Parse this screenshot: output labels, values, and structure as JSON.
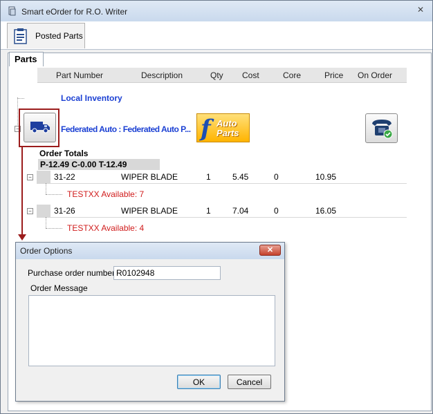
{
  "window": {
    "title": "Smart eOrder for R.O. Writer",
    "close_glyph": "✕"
  },
  "toolbar": {
    "posted_parts_label": "Posted Parts"
  },
  "tabs": {
    "parts_label": "Parts"
  },
  "grid": {
    "columns": [
      "Part Number",
      "Description",
      "Qty",
      "Cost",
      "Core",
      "Price",
      "On Order"
    ]
  },
  "tree": {
    "local_inventory": "Local Inventory",
    "vendor_name": "Federated Auto : Federated Auto P...",
    "vendor_logo_text": "Auto Parts",
    "order_totals_label": "Order Totals",
    "order_totals_value": "P-12.49 C-0.00 T-12.49"
  },
  "rows": [
    {
      "part_number": "31-22",
      "description": "WIPER BLADE",
      "qty": "1",
      "cost": "5.45",
      "core": "0",
      "price": "10.95",
      "availability": "TESTXX Available: 7"
    },
    {
      "part_number": "31-26",
      "description": "WIPER BLADE",
      "qty": "1",
      "cost": "7.04",
      "core": "0",
      "price": "16.05",
      "availability": "TESTXX Available: 4"
    }
  ],
  "dialog": {
    "title": "Order Options",
    "close_glyph": "✕",
    "po_label": "Purchase order number:",
    "po_value": "R0102948",
    "message_label": "Order Message",
    "message_value": "",
    "ok_label": "OK",
    "cancel_label": "Cancel"
  },
  "colors": {
    "accent_red": "#9b1c1c",
    "link_blue": "#1a3fd3",
    "availability_red": "#d01b1b"
  }
}
